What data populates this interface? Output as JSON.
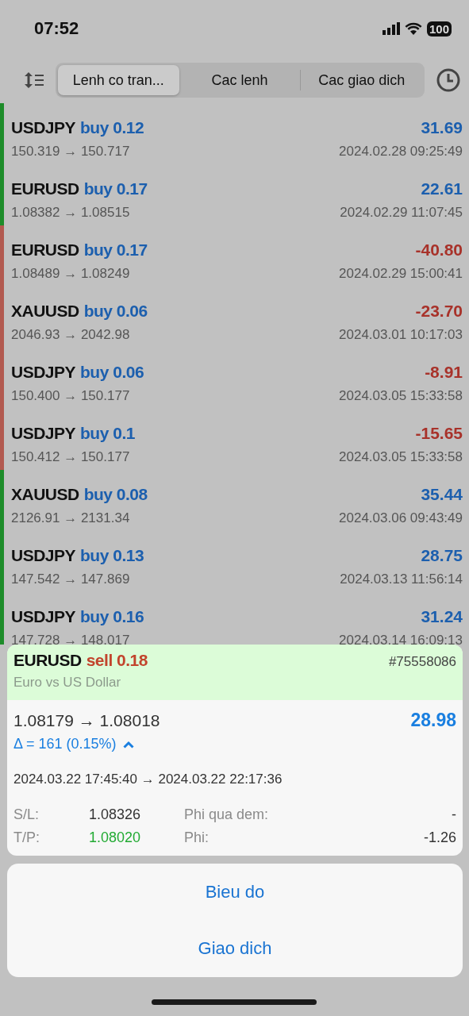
{
  "status_bar": {
    "time": "07:52",
    "battery": "100"
  },
  "tabs": [
    {
      "label": "Lenh co tran...",
      "selected": true
    },
    {
      "label": "Cac lenh",
      "selected": false
    },
    {
      "label": "Cac giao dich",
      "selected": false
    }
  ],
  "orders": [
    {
      "symbol": "USDJPY",
      "sell": false,
      "order": "buy 0.12",
      "profit": "31.69",
      "loss": false,
      "prices": "150.319 → 150.717",
      "time": "2024.02.28 09:25:49"
    },
    {
      "symbol": "EURUSD",
      "sell": false,
      "order": "buy 0.17",
      "profit": "22.61",
      "loss": false,
      "prices": "1.08382 → 1.08515",
      "time": "2024.02.29 11:07:45"
    },
    {
      "symbol": "EURUSD",
      "sell": false,
      "order": "buy 0.17",
      "profit": "-40.80",
      "loss": true,
      "prices": "1.08489 → 1.08249",
      "time": "2024.02.29 15:00:41"
    },
    {
      "symbol": "XAUUSD",
      "sell": false,
      "order": "buy 0.06",
      "profit": "-23.70",
      "loss": true,
      "prices": "2046.93 → 2042.98",
      "time": "2024.03.01 10:17:03"
    },
    {
      "symbol": "USDJPY",
      "sell": false,
      "order": "buy 0.06",
      "profit": "-8.91",
      "loss": true,
      "prices": "150.400 → 150.177",
      "time": "2024.03.05 15:33:58"
    },
    {
      "symbol": "USDJPY",
      "sell": false,
      "order": "buy 0.1",
      "profit": "-15.65",
      "loss": true,
      "prices": "150.412 → 150.177",
      "time": "2024.03.05 15:33:58"
    },
    {
      "symbol": "XAUUSD",
      "sell": false,
      "order": "buy 0.08",
      "profit": "35.44",
      "loss": false,
      "prices": "2126.91 → 2131.34",
      "time": "2024.03.06 09:43:49"
    },
    {
      "symbol": "USDJPY",
      "sell": false,
      "order": "buy 0.13",
      "profit": "28.75",
      "loss": false,
      "prices": "147.542 → 147.869",
      "time": "2024.03.13 11:56:14"
    },
    {
      "symbol": "USDJPY",
      "sell": false,
      "order": "buy 0.16",
      "profit": "31.24",
      "loss": false,
      "prices": "147.728 → 148.017",
      "time": "2024.03.14 16:09:13"
    }
  ],
  "detail": {
    "symbol": "EURUSD",
    "sell": true,
    "order": "sell 0.18",
    "ticket": "#75558086",
    "description": "Euro vs US Dollar",
    "prices": "1.08179 → 1.08018",
    "profit": "28.98",
    "delta": "Δ = 161 (0.15%)",
    "expanded": true,
    "times": "2024.03.22 17:45:40 → 2024.03.22 22:17:36",
    "fields": [
      {
        "label": "S/L:",
        "value": "1.08326",
        "highlighted": false
      },
      {
        "label": "Phi qua dem:",
        "value": "-",
        "highlighted": false
      },
      {
        "label": "T/P:",
        "value": "1.08020",
        "highlighted": true
      },
      {
        "label": "Phi:",
        "value": "-1.26",
        "highlighted": false
      }
    ]
  },
  "actions": [
    "Bieu do",
    "Giao dich"
  ]
}
